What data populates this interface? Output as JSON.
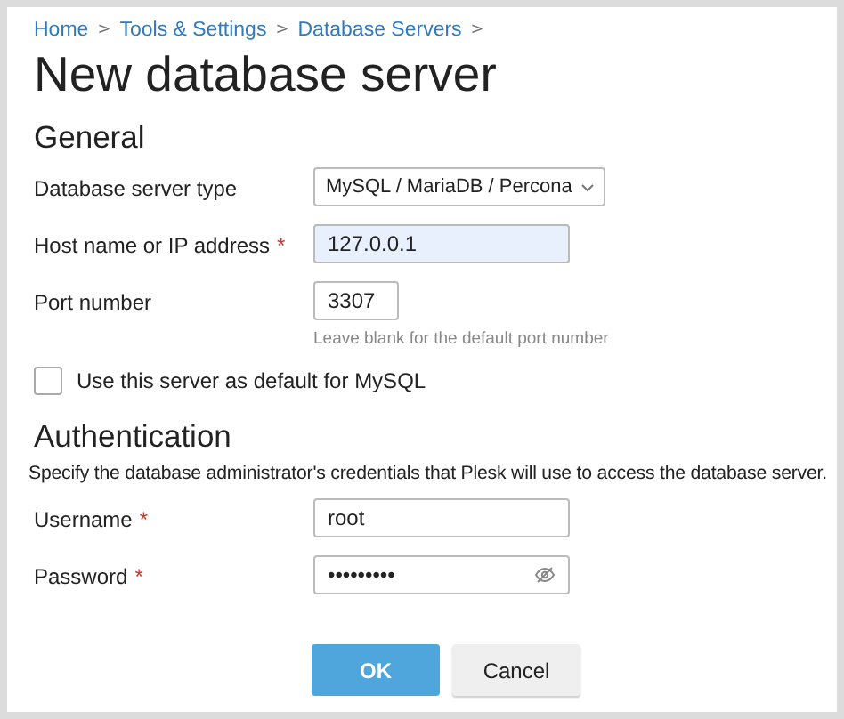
{
  "breadcrumbs": [
    "Home",
    "Tools & Settings",
    "Database Servers"
  ],
  "breadcrumb_separator": ">",
  "title": "New database server",
  "sections": [
    {
      "heading": "General",
      "fields": [
        {
          "kind": "select",
          "label": "Database server type",
          "required": false,
          "value": "MySQL / MariaDB / Percona"
        },
        {
          "kind": "text",
          "label": "Host name or IP address",
          "required": true,
          "value": "127.0.0.1",
          "highlighted": true
        },
        {
          "kind": "short",
          "label": "Port number",
          "required": false,
          "value": "3307",
          "hint": "Leave blank for the default port number"
        },
        {
          "kind": "checkbox",
          "label": "Use this server as default for MySQL",
          "checked": false
        }
      ]
    },
    {
      "heading": "Authentication",
      "description": "Specify the database administrator's credentials that Plesk will use to access the database server.",
      "fields": [
        {
          "kind": "text",
          "label": "Username",
          "required": true,
          "value": "root",
          "highlighted": false
        },
        {
          "kind": "password",
          "label": "Password",
          "required": true,
          "value": "•••••••••"
        }
      ]
    }
  ],
  "required_mark": "*",
  "buttons": [
    {
      "label": "OK",
      "primary": true
    },
    {
      "label": "Cancel",
      "primary": false
    }
  ]
}
